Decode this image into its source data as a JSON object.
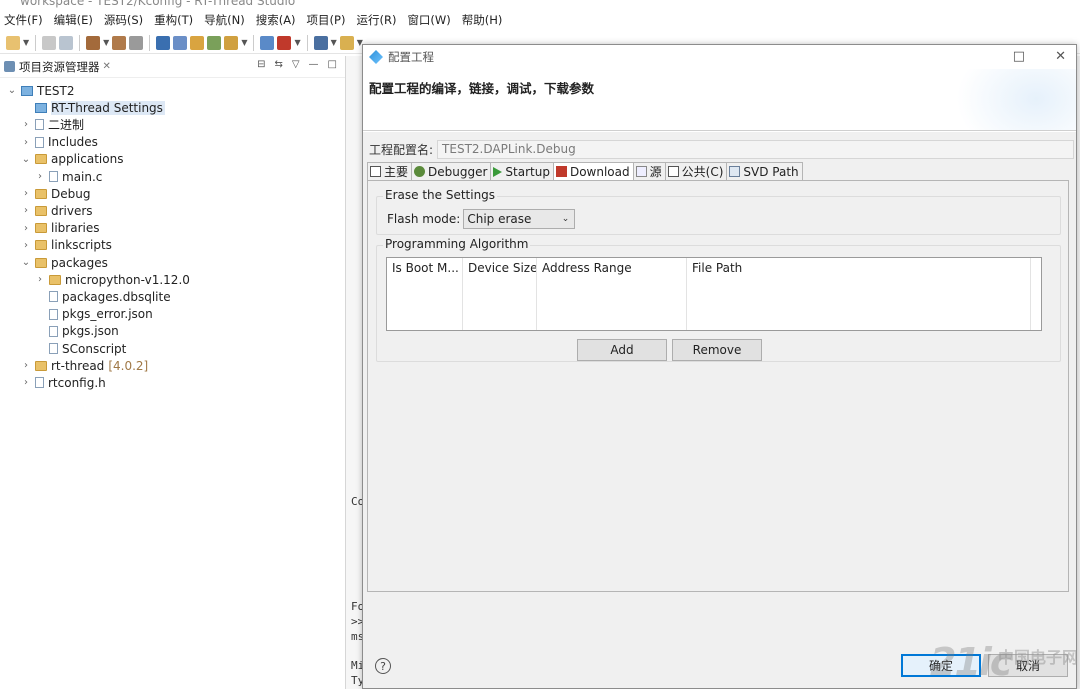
{
  "window": {
    "title": "workspace - TEST2/Kconfig - RT-Thread Studio"
  },
  "menubar": {
    "items": [
      "文件(F)",
      "编辑(E)",
      "源码(S)",
      "重构(T)",
      "导航(N)",
      "搜索(A)",
      "项目(P)",
      "运行(R)",
      "窗口(W)",
      "帮助(H)"
    ]
  },
  "explorer": {
    "title": "项目资源管理器",
    "tree": [
      {
        "label": "TEST2",
        "level": 0,
        "twisty": "v",
        "icon": "project-icon"
      },
      {
        "label": "RT-Thread Settings",
        "level": 1,
        "twisty": "",
        "icon": "rt-settings-icon",
        "selected": true
      },
      {
        "label": "二进制",
        "level": 1,
        "twisty": ">",
        "icon": "binaries-icon"
      },
      {
        "label": "Includes",
        "level": 1,
        "twisty": ">",
        "icon": "includes-icon"
      },
      {
        "label": "applications",
        "level": 1,
        "twisty": "v",
        "icon": "folder-icon"
      },
      {
        "label": "main.c",
        "level": 2,
        "twisty": ">",
        "icon": "c-file-icon"
      },
      {
        "label": "Debug",
        "level": 1,
        "twisty": ">",
        "icon": "folder-icon"
      },
      {
        "label": "drivers",
        "level": 1,
        "twisty": ">",
        "icon": "folder-icon"
      },
      {
        "label": "libraries",
        "level": 1,
        "twisty": ">",
        "icon": "folder-icon"
      },
      {
        "label": "linkscripts",
        "level": 1,
        "twisty": ">",
        "icon": "folder-icon"
      },
      {
        "label": "packages",
        "level": 1,
        "twisty": "v",
        "icon": "folder-icon"
      },
      {
        "label": "micropython-v1.12.0",
        "level": 2,
        "twisty": ">",
        "icon": "folder-icon"
      },
      {
        "label": "packages.dbsqlite",
        "level": 2,
        "twisty": "",
        "icon": "file-icon"
      },
      {
        "label": "pkgs_error.json",
        "level": 2,
        "twisty": "",
        "icon": "file-icon"
      },
      {
        "label": "pkgs.json",
        "level": 2,
        "twisty": "",
        "icon": "file-icon"
      },
      {
        "label": "SConscript",
        "level": 2,
        "twisty": "",
        "icon": "file-icon"
      },
      {
        "label": "rt-thread",
        "level": 1,
        "twisty": ">",
        "icon": "folder-icon",
        "version": "[4.0.2]"
      },
      {
        "label": "rtconfig.h",
        "level": 1,
        "twisty": ">",
        "icon": "h-file-icon"
      }
    ]
  },
  "console_fragments": [
    "Co",
    "Fo",
    ">>",
    "ms",
    "Mi",
    "Ty"
  ],
  "dialog": {
    "title": "配置工程",
    "heading": "配置工程的编译，链接，调试，下载参数",
    "config_label": "工程配置名:",
    "config_value": "TEST2.DAPLink.Debug",
    "tabs": [
      {
        "label": "主要",
        "icon": "main-tab-icon"
      },
      {
        "label": "Debugger",
        "icon": "debugger-tab-icon"
      },
      {
        "label": "Startup",
        "icon": "startup-tab-icon"
      },
      {
        "label": "Download",
        "icon": "download-tab-icon",
        "active": true
      },
      {
        "label": "源",
        "icon": "source-tab-icon"
      },
      {
        "label": "公共(C)",
        "icon": "common-tab-icon"
      },
      {
        "label": "SVD Path",
        "icon": "svd-tab-icon"
      }
    ],
    "erase_group_title": "Erase the Settings",
    "flash_mode_label": "Flash mode:",
    "flash_mode_value": "Chip erase",
    "algo_group_title": "Programming Algorithm",
    "algo_columns": [
      "Is Boot M...",
      "Device Size",
      "Address Range",
      "File Path"
    ],
    "add_label": "Add",
    "remove_label": "Remove",
    "ok_label": "确定",
    "cancel_label": "取消",
    "help_glyph": "?"
  },
  "watermark": {
    "text": "21ic",
    "subtext": "中国电子网"
  },
  "colors": {
    "accent": "#0078d7",
    "folder": "#e9c168",
    "selection": "#dde8f5",
    "version": "#a07846"
  }
}
